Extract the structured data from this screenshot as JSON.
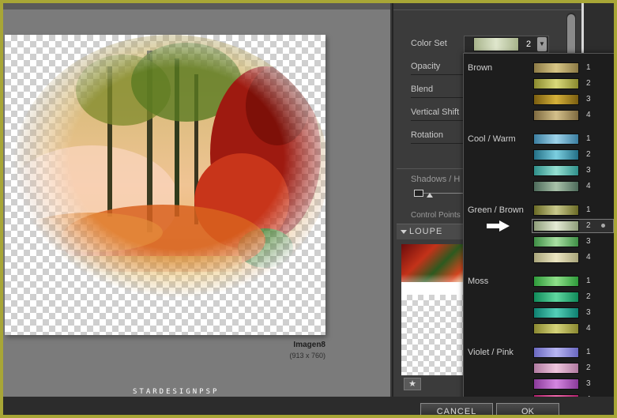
{
  "preview": {
    "image_name": "Imagen8",
    "image_size": "(913 x 760)"
  },
  "watermark": "STARDESIGNPSP",
  "buttons": {
    "cancel": "CANCEL",
    "ok": "OK"
  },
  "controls": {
    "color_set_label": "Color Set",
    "color_set_value": "2",
    "opacity_label": "Opacity",
    "blend_label": "Blend",
    "vertical_shift_label": "Vertical Shift",
    "rotation_label": "Rotation",
    "shadows_label": "Shadows / H",
    "control_points_label": "Control Points",
    "loupe_label": "LOUPE"
  },
  "dropdown": {
    "groups": [
      {
        "name": "Brown",
        "items": [
          {
            "num": "1",
            "colors": [
              "#8c7a45",
              "#d8c686",
              "#8c7a45"
            ]
          },
          {
            "num": "2",
            "colors": [
              "#8a8a2e",
              "#d9d97a",
              "#8a8a2e"
            ]
          },
          {
            "num": "3",
            "colors": [
              "#7a5e10",
              "#d6b13a",
              "#7a5e10"
            ]
          },
          {
            "num": "4",
            "colors": [
              "#7e6a40",
              "#d4c08a",
              "#7e6a40"
            ]
          }
        ]
      },
      {
        "name": "Cool / Warm",
        "items": [
          {
            "num": "1",
            "colors": [
              "#3b7ea0",
              "#9ed3ea",
              "#3b7ea0"
            ]
          },
          {
            "num": "2",
            "colors": [
              "#236f86",
              "#7ccfe0",
              "#236f86"
            ]
          },
          {
            "num": "3",
            "colors": [
              "#2f8f8a",
              "#96e0d2",
              "#2f8f8a"
            ]
          },
          {
            "num": "4",
            "colors": [
              "#4d6a5a",
              "#a9c2aa",
              "#4d6a5a"
            ]
          }
        ]
      },
      {
        "name": "Green / Brown",
        "items": [
          {
            "num": "1",
            "colors": [
              "#6a6a25",
              "#c9c98c",
              "#6a6a25"
            ]
          },
          {
            "num": "2",
            "colors": [
              "#8f9e7a",
              "#e5ebd5",
              "#8f9e7a"
            ]
          },
          {
            "num": "3",
            "colors": [
              "#3e8f45",
              "#a9e0a3",
              "#3e8f45"
            ]
          },
          {
            "num": "4",
            "colors": [
              "#a9a57a",
              "#ece6c2",
              "#a9a57a"
            ]
          }
        ]
      },
      {
        "name": "Moss",
        "items": [
          {
            "num": "1",
            "colors": [
              "#2e9a3a",
              "#8fe08a",
              "#2e9a3a"
            ]
          },
          {
            "num": "2",
            "colors": [
              "#108a5a",
              "#5fd8a0",
              "#108a5a"
            ]
          },
          {
            "num": "3",
            "colors": [
              "#0e8070",
              "#54d0b8",
              "#0e8070"
            ]
          },
          {
            "num": "4",
            "colors": [
              "#8a8830",
              "#d6d47a",
              "#8a8830"
            ]
          }
        ]
      },
      {
        "name": "Violet / Pink",
        "items": [
          {
            "num": "1",
            "colors": [
              "#6a68c0",
              "#b8b6f2",
              "#6a68c0"
            ]
          },
          {
            "num": "2",
            "colors": [
              "#b07aa0",
              "#f0c6de",
              "#b07aa0"
            ]
          },
          {
            "num": "3",
            "colors": [
              "#8a3a9a",
              "#d486e0",
              "#8a3a9a"
            ]
          },
          {
            "num": "4",
            "colors": [
              "#b01e6a",
              "#f06aac",
              "#b01e6a"
            ]
          }
        ]
      }
    ],
    "selected_group": "Green / Brown",
    "selected_num": "2"
  },
  "icons": {
    "pin": "pin-icon",
    "arrow": "right-arrow-icon",
    "dropdown": "chevron-down-icon"
  }
}
